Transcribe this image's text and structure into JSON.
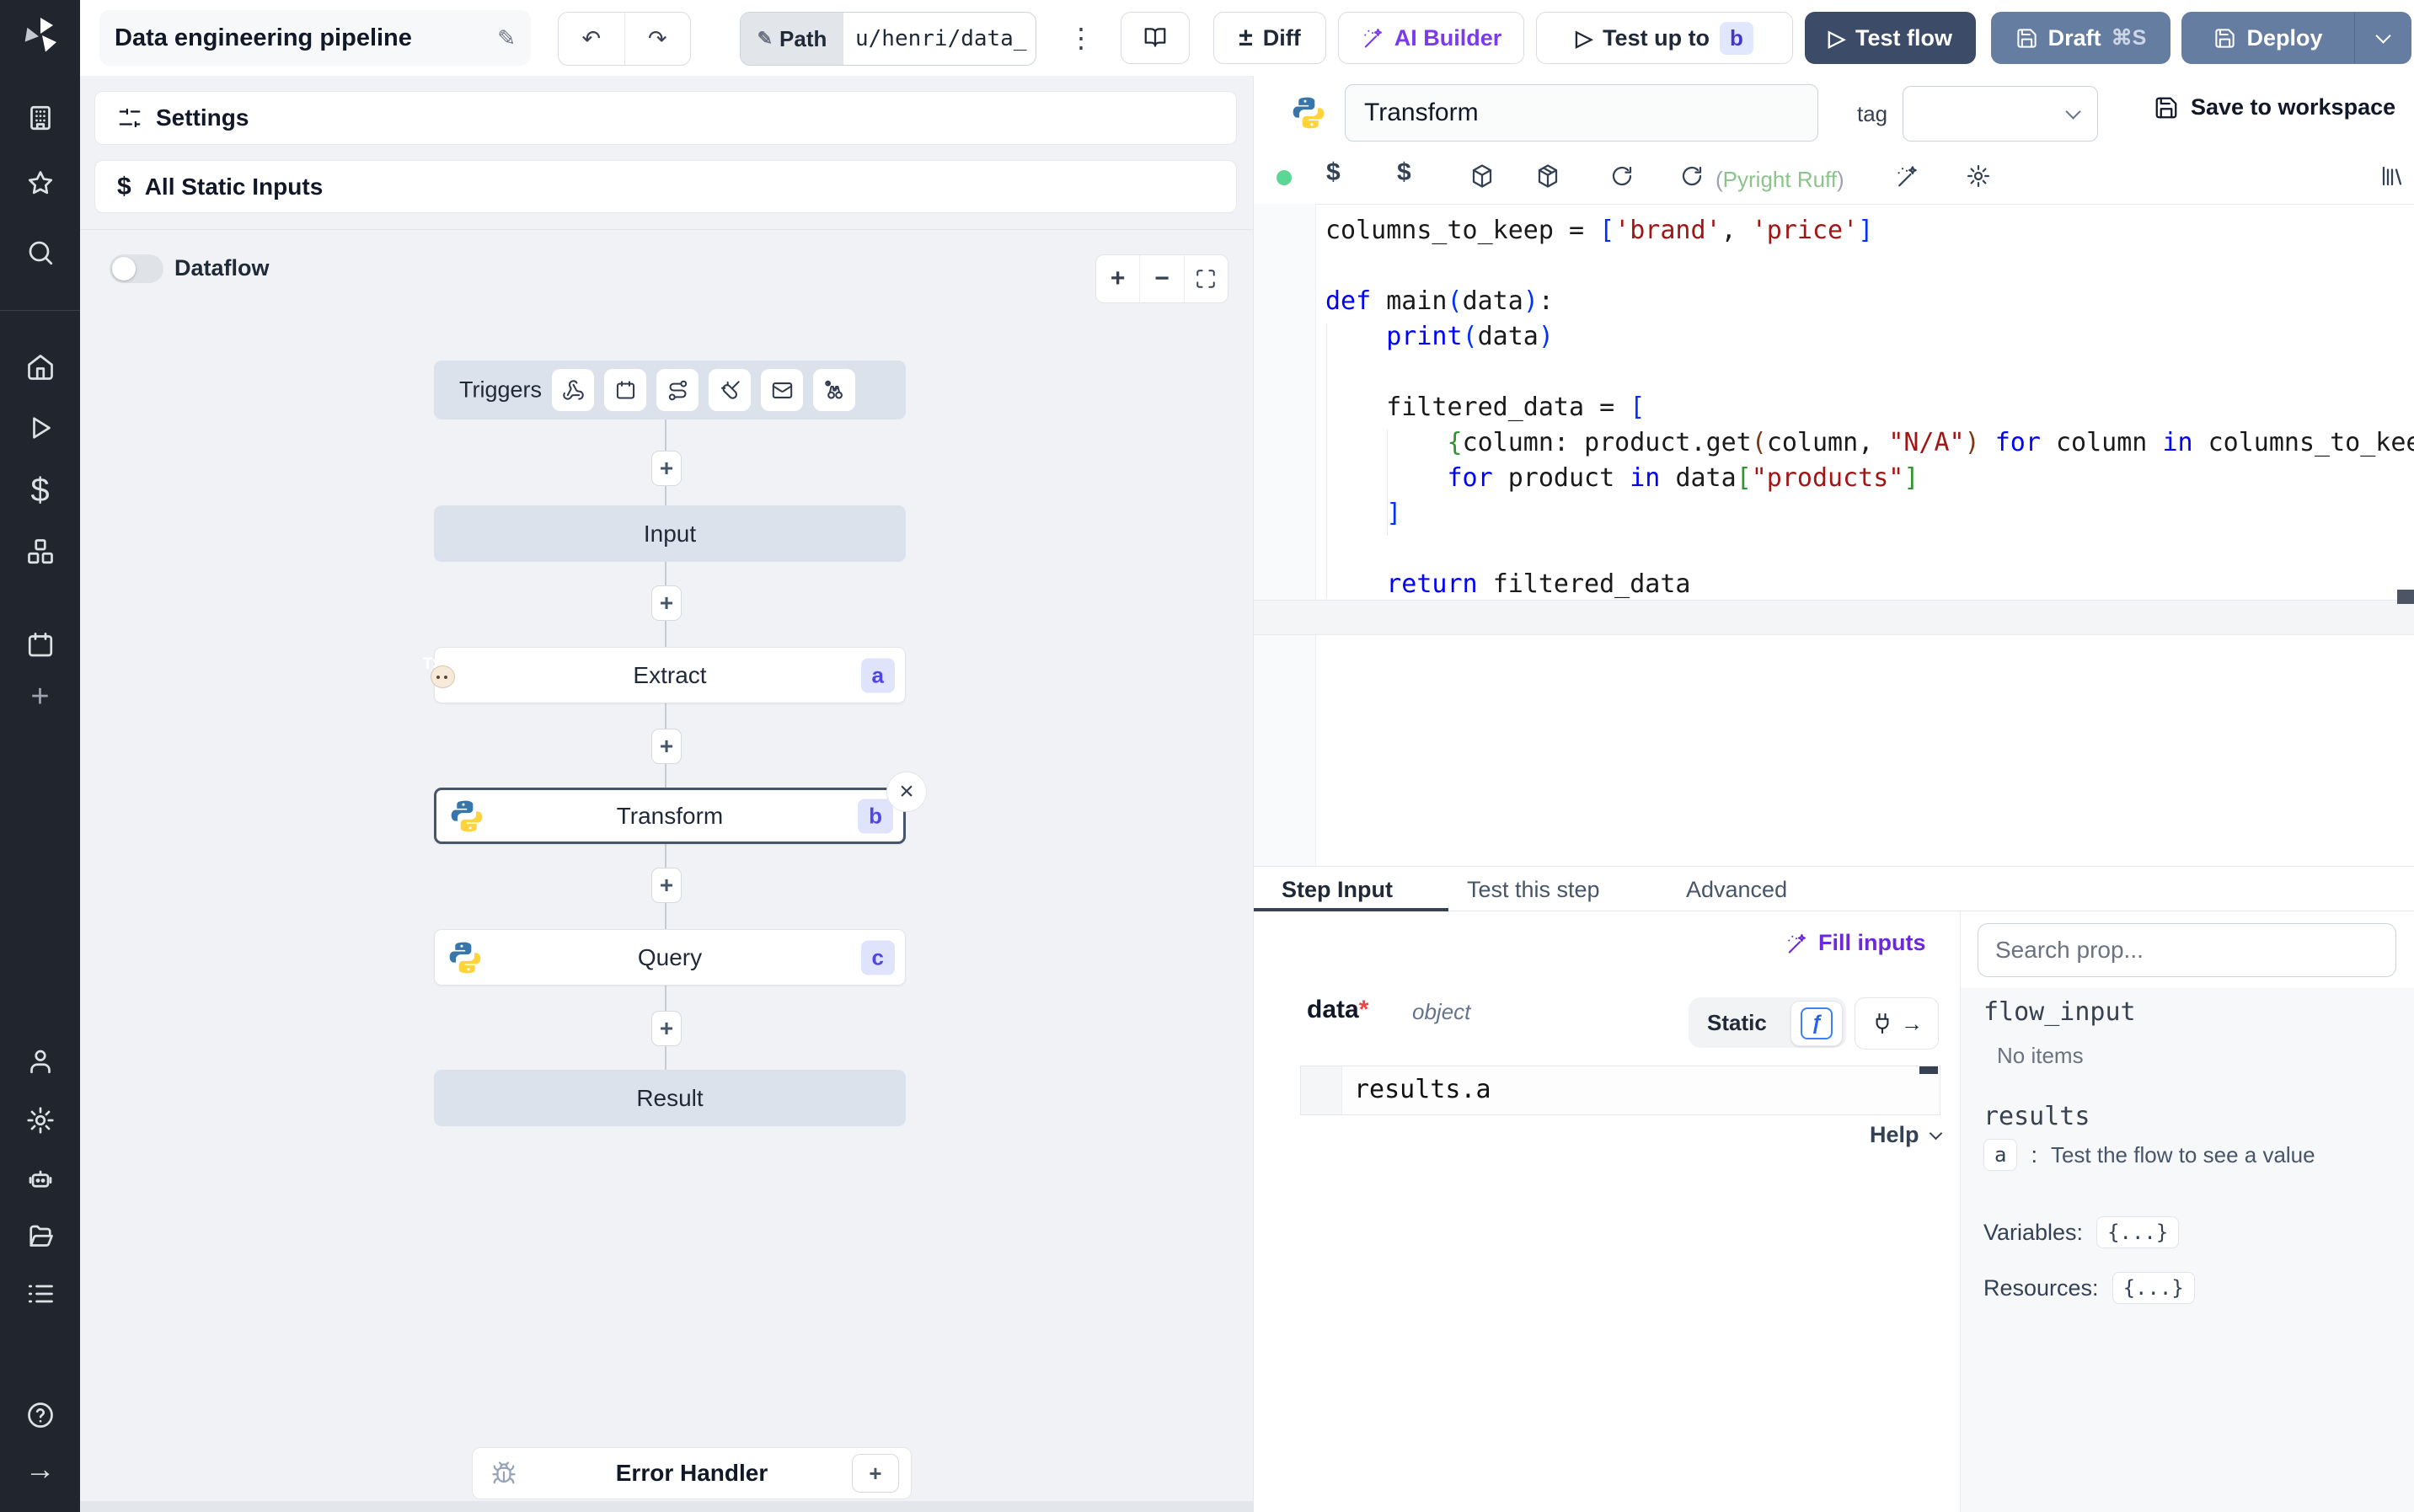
{
  "topbar": {
    "title": "Data engineering pipeline",
    "path_label": "Path",
    "path_value": "u/henri/data_",
    "diff_label": "Diff",
    "ai_builder_label": "AI Builder",
    "test_up_to_label": "Test up to",
    "test_up_to_badge": "b",
    "test_flow_label": "Test flow",
    "draft_label": "Draft",
    "draft_shortcut": "⌘S",
    "deploy_label": "Deploy",
    "icons": [
      "windmill-logo",
      "edit-pencil-icon",
      "undo-icon",
      "redo-icon",
      "kebab-menu-icon",
      "book-icon",
      "diff-icon",
      "wand-icon",
      "play-icon",
      "save-icon",
      "chevron-down-icon"
    ]
  },
  "sidebar": {
    "icons": [
      "workspace-icon",
      "favorites-icon",
      "search-icon",
      "home-icon",
      "runs-icon",
      "variables-icon",
      "resources-icon",
      "schedules-icon",
      "add-icon",
      "user-icon",
      "settings-icon",
      "workers-icon",
      "folders-icon",
      "logs-icon",
      "help-icon",
      "expand-icon"
    ]
  },
  "canvas": {
    "settings_label": "Settings",
    "static_inputs_label": "All Static Inputs",
    "dataflow_label": "Dataflow",
    "triggers_label": "Triggers",
    "trigger_icons": [
      "webhook-icon",
      "schedule-icon",
      "route-icon",
      "websocket-icon",
      "email-icon",
      "poll-icon"
    ],
    "input_label": "Input",
    "extract_label": "Extract",
    "extract_badge": "a",
    "extract_lang": "bun-typescript",
    "transform_label": "Transform",
    "transform_badge": "b",
    "transform_lang": "python",
    "query_label": "Query",
    "query_badge": "c",
    "query_lang": "python",
    "result_label": "Result",
    "error_handler_label": "Error Handler"
  },
  "editor": {
    "step_name": "Transform",
    "tag_label": "tag",
    "save_label": "Save to workspace",
    "lint_open": "(",
    "lint_name": "Pyright Ruff",
    "lint_close": ")",
    "status_color": "#5bd693",
    "toolbar_icons": [
      "status-dot",
      "variable-icon",
      "static-variable-icon",
      "package-icon",
      "package-icon",
      "reload-icon",
      "reset-icon",
      "ai-wand-icon",
      "editor-settings-icon",
      "library-icon"
    ],
    "code_lines": [
      [
        [
          "v",
          "columns_to_keep"
        ],
        [
          "o",
          " = "
        ],
        [
          "b1",
          "["
        ],
        [
          "s",
          "'brand'"
        ],
        [
          "o",
          ", "
        ],
        [
          "s",
          "'price'"
        ],
        [
          "b1",
          "]"
        ]
      ],
      [],
      [
        [
          "k",
          "def"
        ],
        [
          "o",
          " "
        ],
        [
          "v",
          "main"
        ],
        [
          "b1",
          "("
        ],
        [
          "v",
          "data"
        ],
        [
          "b1",
          ")"
        ],
        [
          "o",
          ":"
        ]
      ],
      [
        [
          "o",
          "    "
        ],
        [
          "k",
          "print"
        ],
        [
          "b1",
          "("
        ],
        [
          "v",
          "data"
        ],
        [
          "b1",
          ")"
        ]
      ],
      [],
      [
        [
          "o",
          "    "
        ],
        [
          "v",
          "filtered_data"
        ],
        [
          "o",
          " = "
        ],
        [
          "b1",
          "["
        ]
      ],
      [
        [
          "o",
          "        "
        ],
        [
          "b2",
          "{"
        ],
        [
          "v",
          "column"
        ],
        [
          "o",
          ": "
        ],
        [
          "v",
          "product"
        ],
        [
          "o",
          "."
        ],
        [
          "v",
          "get"
        ],
        [
          "b3",
          "("
        ],
        [
          "v",
          "column"
        ],
        [
          "o",
          ", "
        ],
        [
          "s",
          "\"N/A\""
        ],
        [
          "b3",
          ")"
        ],
        [
          "o",
          " "
        ],
        [
          "k",
          "for"
        ],
        [
          "o",
          " "
        ],
        [
          "v",
          "column"
        ],
        [
          "o",
          " "
        ],
        [
          "k",
          "in"
        ],
        [
          "o",
          " "
        ],
        [
          "v",
          "columns_to_keep"
        ],
        [
          "b2",
          "}"
        ]
      ],
      [
        [
          "o",
          "        "
        ],
        [
          "k",
          "for"
        ],
        [
          "o",
          " "
        ],
        [
          "v",
          "product"
        ],
        [
          "o",
          " "
        ],
        [
          "k",
          "in"
        ],
        [
          "o",
          " "
        ],
        [
          "v",
          "data"
        ],
        [
          "b2",
          "["
        ],
        [
          "s",
          "\"products\""
        ],
        [
          "b2",
          "]"
        ]
      ],
      [
        [
          "o",
          "    "
        ],
        [
          "b1",
          "]"
        ]
      ],
      [],
      [
        [
          "o",
          "    "
        ],
        [
          "k",
          "return"
        ],
        [
          "o",
          " "
        ],
        [
          "v",
          "filtered_data"
        ]
      ]
    ]
  },
  "bottom": {
    "tabs": [
      "Step Input",
      "Test this step",
      "Advanced"
    ],
    "fill_inputs_label": "Fill inputs",
    "arg_name": "data",
    "arg_required": "*",
    "arg_type": "object",
    "static_label": "Static",
    "expr_value": "results.a",
    "help_label": "Help"
  },
  "props": {
    "search_placeholder": "Search prop...",
    "flow_input_label": "flow_input",
    "flow_input_empty": "No items",
    "results_label": "results",
    "result_key": "a",
    "result_sep": ":",
    "result_hint": "Test the flow to see a value",
    "variables_label": "Variables:",
    "variables_value": "{...}",
    "resources_label": "Resources:",
    "resources_value": "{...}"
  }
}
